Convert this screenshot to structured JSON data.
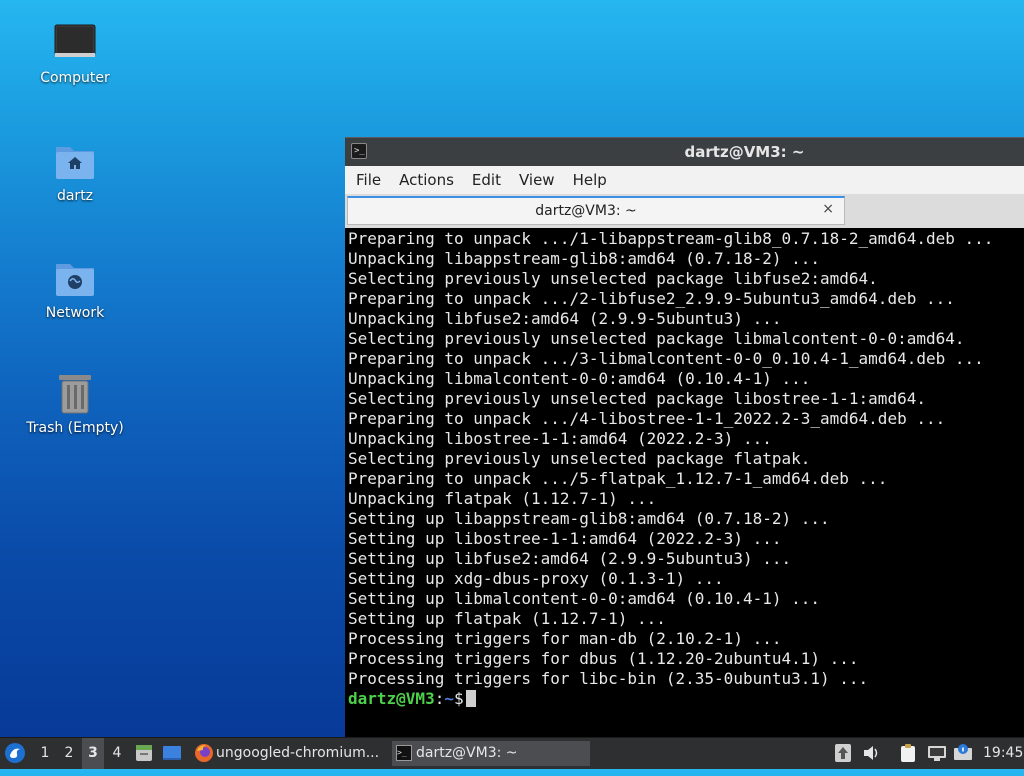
{
  "desktop": {
    "icons": [
      {
        "label": "Computer"
      },
      {
        "label": "dartz"
      },
      {
        "label": "Network"
      },
      {
        "label": "Trash (Empty)"
      }
    ]
  },
  "terminal": {
    "title": "dartz@VM3: ~",
    "menu": [
      "File",
      "Actions",
      "Edit",
      "View",
      "Help"
    ],
    "tab_label": "dartz@VM3: ~",
    "tab_close": "×",
    "lines": [
      "Preparing to unpack .../1-libappstream-glib8_0.7.18-2_amd64.deb ...",
      "Unpacking libappstream-glib8:amd64 (0.7.18-2) ...",
      "Selecting previously unselected package libfuse2:amd64.",
      "Preparing to unpack .../2-libfuse2_2.9.9-5ubuntu3_amd64.deb ...",
      "Unpacking libfuse2:amd64 (2.9.9-5ubuntu3) ...",
      "Selecting previously unselected package libmalcontent-0-0:amd64.",
      "Preparing to unpack .../3-libmalcontent-0-0_0.10.4-1_amd64.deb ...",
      "Unpacking libmalcontent-0-0:amd64 (0.10.4-1) ...",
      "Selecting previously unselected package libostree-1-1:amd64.",
      "Preparing to unpack .../4-libostree-1-1_2022.2-3_amd64.deb ...",
      "Unpacking libostree-1-1:amd64 (2022.2-3) ...",
      "Selecting previously unselected package flatpak.",
      "Preparing to unpack .../5-flatpak_1.12.7-1_amd64.deb ...",
      "Unpacking flatpak (1.12.7-1) ...",
      "Setting up libappstream-glib8:amd64 (0.7.18-2) ...",
      "Setting up libostree-1-1:amd64 (2022.2-3) ...",
      "Setting up libfuse2:amd64 (2.9.9-5ubuntu3) ...",
      "Setting up xdg-dbus-proxy (0.1.3-1) ...",
      "Setting up libmalcontent-0-0:amd64 (0.10.4-1) ...",
      "Setting up flatpak (1.12.7-1) ...",
      "Processing triggers for man-db (2.10.2-1) ...",
      "Processing triggers for dbus (1.12.20-2ubuntu4.1) ...",
      "Processing triggers for libc-bin (2.35-0ubuntu3.1) ..."
    ],
    "prompt": {
      "user_host": "dartz@VM3",
      "sep": ":",
      "dir": "~",
      "symbol": "$"
    }
  },
  "taskbar": {
    "workspaces": [
      "1",
      "2",
      "3",
      "4"
    ],
    "active_workspace": "3",
    "tasks": [
      {
        "label": "ungoogled-chromium..."
      },
      {
        "label": "dartz@VM3: ~"
      }
    ],
    "clock": "19:45"
  },
  "colors": {
    "prompt_user": "#4ed14a",
    "prompt_dir": "#4f7bd9",
    "tab_accent": "#3d8ee6"
  }
}
